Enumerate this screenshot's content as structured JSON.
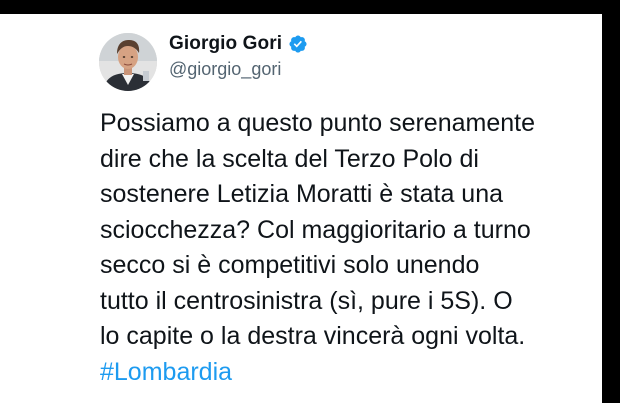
{
  "author": {
    "display_name": "Giorgio Gori",
    "handle": "@giorgio_gori",
    "verified": true,
    "verified_color": "#1d9bf0"
  },
  "tweet": {
    "lines": [
      "Possiamo a questo punto serenamente",
      "dire che la scelta del Terzo Polo di",
      "sostenere Letizia Moratti è stata una",
      "sciocchezza? Col maggioritario a turno",
      "secco si è competitivi solo unendo",
      "tutto il centrosinistra (sì, pure i 5S). O",
      "lo capite o la destra vincerà ogni volta."
    ],
    "hashtag": "#Lombardia",
    "hashtag_color": "#1d9bf0",
    "text_color": "#0f1419"
  },
  "icons": {
    "avatar": "profile-photo",
    "verified": "verified-badge-icon"
  }
}
